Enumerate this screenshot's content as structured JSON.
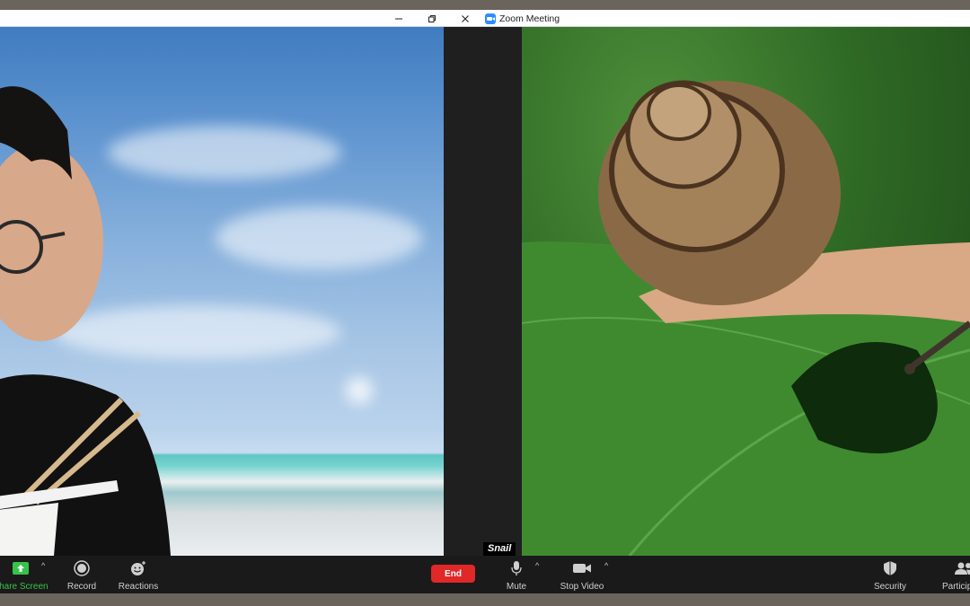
{
  "window": {
    "title": "Zoom Meeting",
    "controls": {
      "minimize_icon": "minimize-icon",
      "restore_icon": "restore-icon",
      "close_icon": "close-icon"
    }
  },
  "participants": [
    {
      "id": "left",
      "scene": "person eating noodles in front of a beach background"
    },
    {
      "id": "right",
      "scene": "snail on a green leaf",
      "name": "Snail"
    }
  ],
  "toolbar": {
    "share_screen": {
      "label": "Share Screen",
      "icon": "share-screen-arrow-icon",
      "color": "#37c34a"
    },
    "record": {
      "label": "Record",
      "icon": "record-icon"
    },
    "reactions": {
      "label": "Reactions",
      "icon": "emoji-add-icon"
    },
    "end": {
      "label": "End",
      "color": "#e02828"
    },
    "mute": {
      "label": "Mute",
      "icon": "microphone-icon"
    },
    "stop_video": {
      "label": "Stop Video",
      "icon": "video-camera-icon"
    },
    "security": {
      "label": "Security",
      "icon": "shield-icon"
    },
    "participants": {
      "label": "Participants",
      "icon": "participants-icon"
    }
  },
  "colors": {
    "toolbar_bg": "#1a1a1a",
    "stage_bg": "#1f1f1f",
    "zoom_blue": "#2d8cff"
  }
}
